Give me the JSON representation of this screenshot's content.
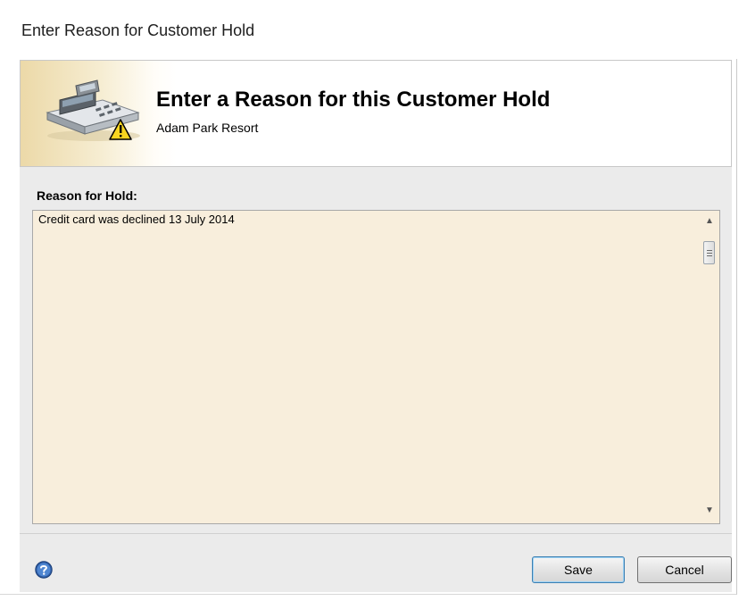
{
  "window": {
    "title": "Enter Reason for Customer Hold"
  },
  "header": {
    "title": "Enter a Reason for this Customer Hold",
    "subtitle": "Adam Park Resort",
    "icon": "cash-register-warning-icon"
  },
  "reason": {
    "label": "Reason for Hold:",
    "text": "Credit card was declined 13 July 2014"
  },
  "scrollbar": {
    "up_glyph": "▲",
    "down_glyph": "▼"
  },
  "footer": {
    "help_icon": "help-icon",
    "save_label": "Save",
    "cancel_label": "Cancel"
  },
  "colors": {
    "textarea_background": "#f8eedc",
    "header_gradient": "#ecd9a8",
    "dialog_background": "#ebebeb",
    "default_button_border": "#3c7fb1"
  }
}
